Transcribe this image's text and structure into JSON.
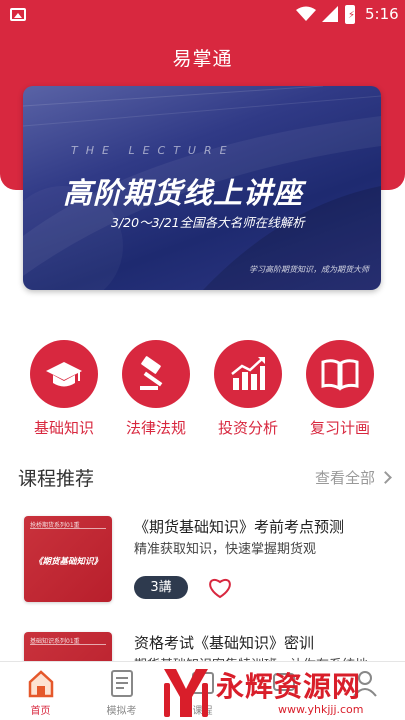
{
  "status_bar": {
    "time": "5:16",
    "icons": [
      "image-icon",
      "wifi-icon",
      "signal-icon",
      "battery-icon"
    ]
  },
  "header": {
    "title": "易掌通"
  },
  "banner": {
    "tagline": "THE LECTURE",
    "headline": "高阶期货线上讲座",
    "subtitle": "3/20～3/21全国各大名师在线解析",
    "slogan": "学习高阶期货知识，成为期货大师"
  },
  "quick_nav": [
    {
      "label": "基础知识",
      "icon": "graduation-cap-icon"
    },
    {
      "label": "法律法规",
      "icon": "gavel-icon"
    },
    {
      "label": "投资分析",
      "icon": "bar-chart-icon"
    },
    {
      "label": "复习计画",
      "icon": "book-icon"
    }
  ],
  "section": {
    "title": "课程推荐",
    "see_all": "查看全部"
  },
  "courses": [
    {
      "thumb_series": "抢桥期货系列01重",
      "thumb_title": "《期货基础知识》",
      "title": "《期货基础知识》考前考点预测",
      "desc": "精准获取知识，快速掌握期货观",
      "lessons": "3講"
    },
    {
      "thumb_series": "基础知识系列01重",
      "title": "资格考试《基础知识》密训",
      "desc": "期货基础知识密集特训班，让你有系统地"
    }
  ],
  "tabbar": [
    {
      "label": "首页",
      "icon": "home-icon"
    },
    {
      "label": "模拟考",
      "icon": "exam-icon"
    },
    {
      "label": "课程",
      "icon": "course-icon"
    },
    {
      "label": "",
      "icon": "message-icon"
    },
    {
      "label": "",
      "icon": "profile-icon"
    }
  ],
  "watermark": {
    "text": "永辉资源网",
    "url": "www.yhkjjj.com"
  },
  "colors": {
    "brand": "#d8283f",
    "banner": "#2a347e",
    "badge": "#2e3a4e"
  }
}
